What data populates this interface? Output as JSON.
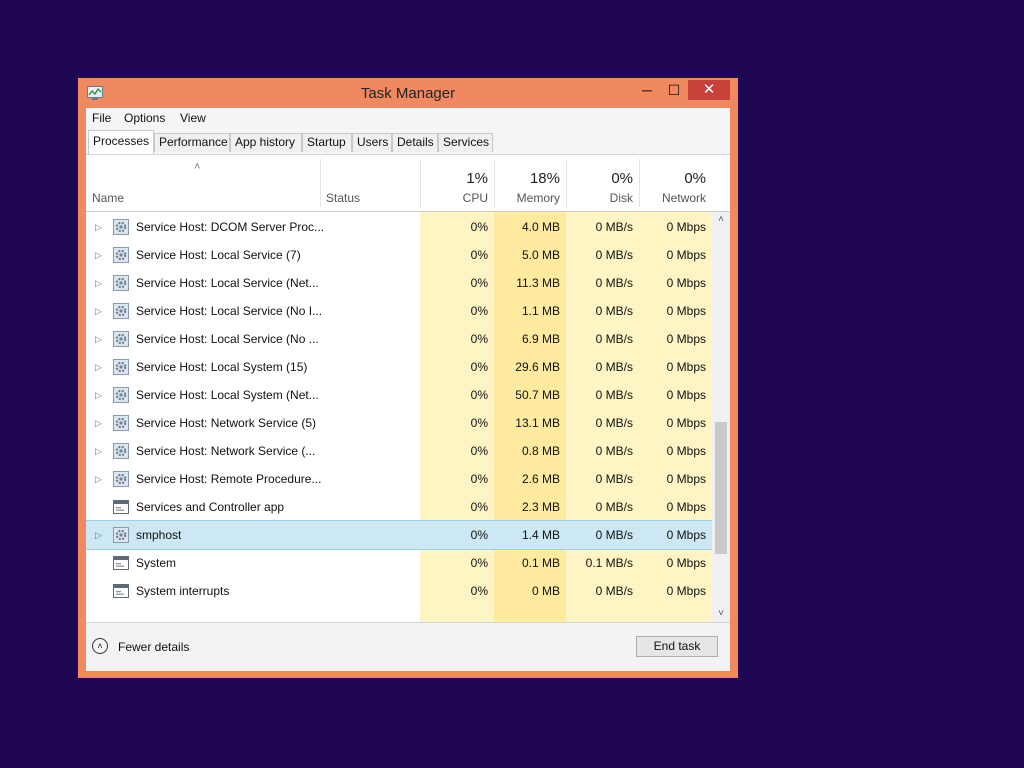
{
  "window": {
    "title": "Task Manager",
    "minimize": "─",
    "maximize": "☐",
    "close": "✕"
  },
  "menu": [
    "File",
    "Options",
    "View"
  ],
  "tabs": [
    {
      "label": "Processes",
      "active": true
    },
    {
      "label": "Performance"
    },
    {
      "label": "App history"
    },
    {
      "label": "Startup"
    },
    {
      "label": "Users"
    },
    {
      "label": "Details"
    },
    {
      "label": "Services"
    }
  ],
  "columns": {
    "name": "Name",
    "status": "Status",
    "cpu": {
      "pct": "1%",
      "label": "CPU"
    },
    "memory": {
      "pct": "18%",
      "label": "Memory"
    },
    "disk": {
      "pct": "0%",
      "label": "Disk"
    },
    "network": {
      "pct": "0%",
      "label": "Network"
    }
  },
  "processes": [
    {
      "name": "Service Host: DCOM Server Proc...",
      "cpu": "0%",
      "memory": "4.0 MB",
      "disk": "0 MB/s",
      "network": "0 Mbps",
      "expandable": true,
      "icon": "gear-icon"
    },
    {
      "name": "Service Host: Local Service (7)",
      "cpu": "0%",
      "memory": "5.0 MB",
      "disk": "0 MB/s",
      "network": "0 Mbps",
      "expandable": true,
      "icon": "gear-icon"
    },
    {
      "name": "Service Host: Local Service (Net...",
      "cpu": "0%",
      "memory": "11.3 MB",
      "disk": "0 MB/s",
      "network": "0 Mbps",
      "expandable": true,
      "icon": "gear-icon"
    },
    {
      "name": "Service Host: Local Service (No I...",
      "cpu": "0%",
      "memory": "1.1 MB",
      "disk": "0 MB/s",
      "network": "0 Mbps",
      "expandable": true,
      "icon": "gear-icon"
    },
    {
      "name": "Service Host: Local Service (No ...",
      "cpu": "0%",
      "memory": "6.9 MB",
      "disk": "0 MB/s",
      "network": "0 Mbps",
      "expandable": true,
      "icon": "gear-icon"
    },
    {
      "name": "Service Host: Local System (15)",
      "cpu": "0%",
      "memory": "29.6 MB",
      "disk": "0 MB/s",
      "network": "0 Mbps",
      "expandable": true,
      "icon": "gear-icon"
    },
    {
      "name": "Service Host: Local System (Net...",
      "cpu": "0%",
      "memory": "50.7 MB",
      "disk": "0 MB/s",
      "network": "0 Mbps",
      "expandable": true,
      "icon": "gear-icon"
    },
    {
      "name": "Service Host: Network Service (5)",
      "cpu": "0%",
      "memory": "13.1 MB",
      "disk": "0 MB/s",
      "network": "0 Mbps",
      "expandable": true,
      "icon": "gear-icon"
    },
    {
      "name": "Service Host: Network Service (...",
      "cpu": "0%",
      "memory": "0.8 MB",
      "disk": "0 MB/s",
      "network": "0 Mbps",
      "expandable": true,
      "icon": "gear-icon"
    },
    {
      "name": "Service Host: Remote Procedure...",
      "cpu": "0%",
      "memory": "2.6 MB",
      "disk": "0 MB/s",
      "network": "0 Mbps",
      "expandable": true,
      "icon": "gear-icon"
    },
    {
      "name": "Services and Controller app",
      "cpu": "0%",
      "memory": "2.3 MB",
      "disk": "0 MB/s",
      "network": "0 Mbps",
      "expandable": false,
      "icon": "window-icon"
    },
    {
      "name": "smphost",
      "cpu": "0%",
      "memory": "1.4 MB",
      "disk": "0 MB/s",
      "network": "0 Mbps",
      "expandable": true,
      "icon": "gear-icon",
      "selected": true
    },
    {
      "name": "System",
      "cpu": "0%",
      "memory": "0.1 MB",
      "disk": "0.1 MB/s",
      "network": "0 Mbps",
      "expandable": false,
      "icon": "window-icon"
    },
    {
      "name": "System interrupts",
      "cpu": "0%",
      "memory": "0 MB",
      "disk": "0 MB/s",
      "network": "0 Mbps",
      "expandable": false,
      "icon": "window-icon"
    }
  ],
  "footer": {
    "fewer_details": "Fewer details",
    "end_task": "End task"
  },
  "colors": {
    "desktop": "#1e0650",
    "window_frame": "#f0895f",
    "close_button": "#c7413a",
    "heat_light": "#fff4c4",
    "heat_medium": "#ffeaa0",
    "selection": "#cce8f4"
  }
}
